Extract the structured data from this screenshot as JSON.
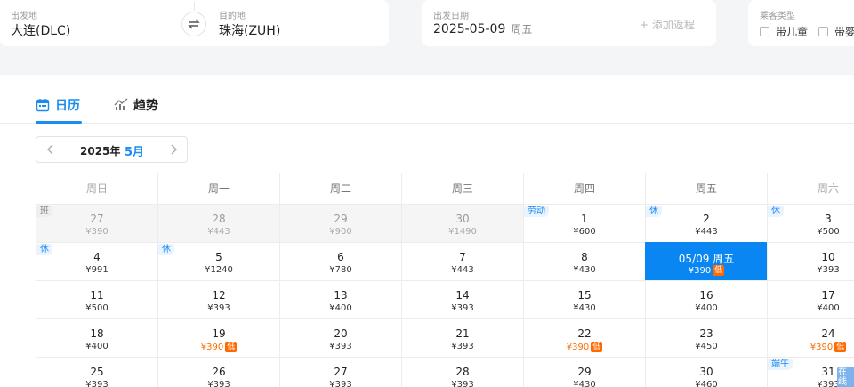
{
  "search": {
    "origin_label": "出发地",
    "origin_value": "大连(DLC)",
    "destination_label": "目的地",
    "destination_value": "珠海(ZUH)",
    "date_label": "出发日期",
    "date_value": "2025-05-09",
    "date_weekday": "周五",
    "add_return": "+ 添加返程",
    "pax_label": "乘客类型",
    "pax_options": [
      "带儿童",
      "带婴"
    ]
  },
  "tabs": [
    {
      "label": "日历",
      "icon": "calendar-icon",
      "active": true
    },
    {
      "label": "趋势",
      "icon": "trend-chart-icon",
      "active": false
    }
  ],
  "month_nav": {
    "year": "2025年",
    "month": "5月"
  },
  "weekdays": [
    "周日",
    "周一",
    "周二",
    "周三",
    "周四",
    "周五",
    "周六"
  ],
  "weeks": [
    [
      {
        "day": "27",
        "price": "¥390",
        "other": true,
        "tag": "班",
        "tag_type": "work"
      },
      {
        "day": "28",
        "price": "¥443",
        "other": true
      },
      {
        "day": "29",
        "price": "¥900",
        "other": true
      },
      {
        "day": "30",
        "price": "¥1490",
        "other": true
      },
      {
        "day": "1",
        "price": "¥600",
        "tag": "劳动",
        "tag_type": "holiday"
      },
      {
        "day": "2",
        "price": "¥443",
        "tag": "休",
        "tag_type": "rest"
      },
      {
        "day": "3",
        "price": "¥500",
        "tag": "休",
        "tag_type": "rest"
      }
    ],
    [
      {
        "day": "4",
        "price": "¥991",
        "tag": "休",
        "tag_type": "rest"
      },
      {
        "day": "5",
        "price": "¥1240",
        "tag": "休",
        "tag_type": "rest"
      },
      {
        "day": "6",
        "price": "¥780"
      },
      {
        "day": "7",
        "price": "¥443"
      },
      {
        "day": "8",
        "price": "¥430"
      },
      {
        "day": "05/09 周五",
        "price": "¥390",
        "low": true,
        "selected": true
      },
      {
        "day": "10",
        "price": "¥393"
      }
    ],
    [
      {
        "day": "11",
        "price": "¥500"
      },
      {
        "day": "12",
        "price": "¥393"
      },
      {
        "day": "13",
        "price": "¥400"
      },
      {
        "day": "14",
        "price": "¥393"
      },
      {
        "day": "15",
        "price": "¥430"
      },
      {
        "day": "16",
        "price": "¥400"
      },
      {
        "day": "17",
        "price": "¥400"
      }
    ],
    [
      {
        "day": "18",
        "price": "¥400"
      },
      {
        "day": "19",
        "price": "¥390",
        "low": true
      },
      {
        "day": "20",
        "price": "¥393"
      },
      {
        "day": "21",
        "price": "¥393"
      },
      {
        "day": "22",
        "price": "¥390",
        "low": true
      },
      {
        "day": "23",
        "price": "¥450"
      },
      {
        "day": "24",
        "price": "¥390",
        "low": true
      }
    ],
    [
      {
        "day": "25",
        "price": "¥393"
      },
      {
        "day": "26",
        "price": "¥393"
      },
      {
        "day": "27",
        "price": "¥393"
      },
      {
        "day": "28",
        "price": "¥393"
      },
      {
        "day": "29",
        "price": "¥430"
      },
      {
        "day": "30",
        "price": "¥460"
      },
      {
        "day": "31",
        "price": "¥393",
        "tag": "端午",
        "tag_type": "holiday"
      }
    ]
  ],
  "low_label": "低",
  "float_help": "在线"
}
